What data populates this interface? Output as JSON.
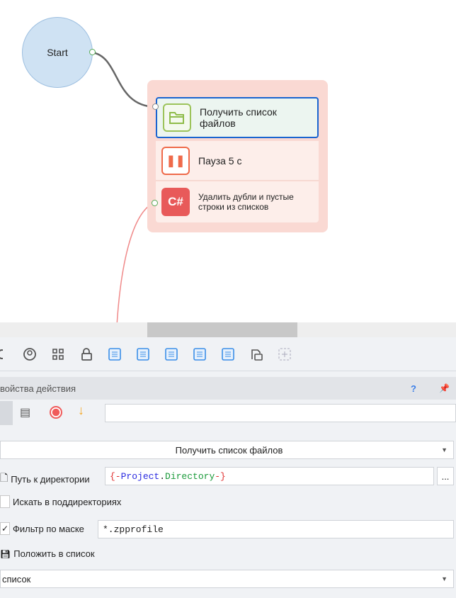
{
  "canvas": {
    "start_label": "Start",
    "nodes": [
      {
        "label": "Получить список файлов",
        "icon": "folder-icon",
        "color": "#8fbc4a",
        "selected": true
      },
      {
        "label": "Пауза 5 с",
        "icon": "pause-icon",
        "color": "#ef6a4a"
      },
      {
        "label": "Удалить дубли и  пустые строки из списков",
        "icon": "csharp-icon",
        "icon_text": "C#",
        "color": "#e85a5a"
      }
    ]
  },
  "toolbar": {
    "icons": [
      "gear-icon",
      "user-icon",
      "grid-icon",
      "lock-icon",
      "list-icon",
      "list-icon",
      "list-icon",
      "list-icon",
      "list-icon",
      "code-file-icon",
      "add-icon"
    ]
  },
  "properties": {
    "title": "войства действия",
    "help": "?",
    "comment_value": "",
    "action_select": "Получить список файлов",
    "path_label": "Путь к директории",
    "path_value": {
      "open": "{-",
      "project": "Project",
      "dot": ".",
      "directory": "Directory",
      "close": "-}"
    },
    "browse": "...",
    "subdirs_label": "Искать в поддиректориях",
    "subdirs_checked": false,
    "mask_label": "Фильтр по маске",
    "mask_checked": true,
    "mask_value": "*.zpprofile",
    "save_label": "Положить в список",
    "list_select": "список"
  }
}
